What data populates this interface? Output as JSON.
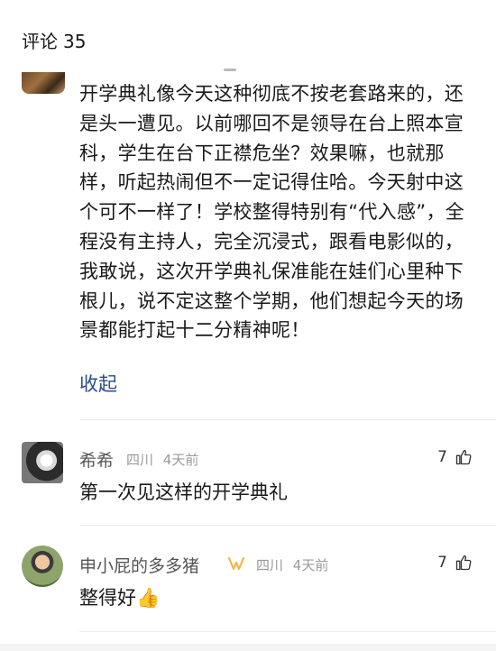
{
  "header": {
    "title": "评论",
    "count": "35"
  },
  "first_comment": {
    "text": "开学典礼像今天这种彻底不按老套路来的，还是头一遭见。以前哪回不是领导在台上照本宣科，学生在台下正襟危坐？效果嘛，也就那样，听起热闹但不一定记得住哈。今天射中这个可不一样了！学校整得特别有“代入感”，全程没有主持人，完全沉浸式，跟看电影似的，我敢说，这次开学典礼保准能在娃们心里种下根儿，说不定这整个学期，他们想起今天的场景都能打起十二分精神呢！",
    "collapse_label": "收起"
  },
  "comments": [
    {
      "name": "希希",
      "location": "四川",
      "time": "4天前",
      "likes": "7",
      "text": "第一次见这样的开学典礼"
    },
    {
      "name": "申小屁的多多猪",
      "location": "四川",
      "time": "4天前",
      "likes": "7",
      "text": "整得好👍"
    }
  ],
  "colors": {
    "link": "#2d4d85",
    "meta": "#9a9a9a",
    "badge": "#f2b64a"
  }
}
